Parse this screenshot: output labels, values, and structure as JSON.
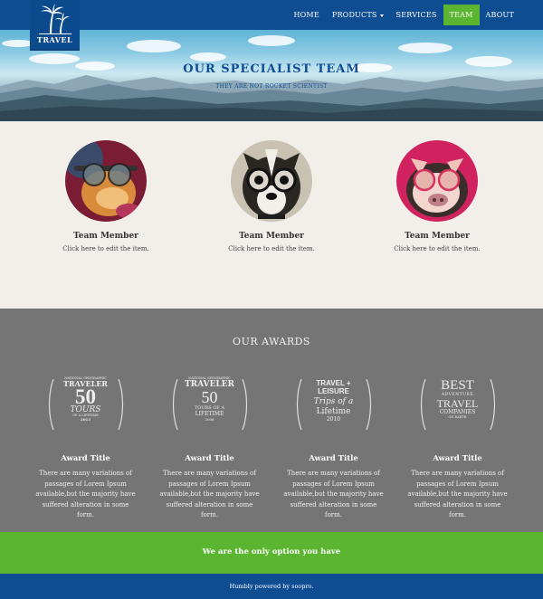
{
  "brand": {
    "name": "TRAVEL",
    "logo_icon": "palm-trees-icon"
  },
  "nav": {
    "items": [
      {
        "label": "HOME",
        "active": false
      },
      {
        "label": "PRODUCTS",
        "active": false,
        "dropdown": true
      },
      {
        "label": "SERVICES",
        "active": false
      },
      {
        "label": "TEAM",
        "active": true
      },
      {
        "label": "ABOUT",
        "active": false
      }
    ]
  },
  "hero": {
    "title": "OUR SPECIALIST TEAM",
    "subtitle": "THEY ARE NOT ROCKET SCIENTIST"
  },
  "team": {
    "members": [
      {
        "name": "Team Member",
        "desc": "Click here to edit the item.",
        "photo": "hamster-with-glasses"
      },
      {
        "name": "Team Member",
        "desc": "Click here to edit the item.",
        "photo": "dog-with-glasses"
      },
      {
        "name": "Team Member",
        "desc": "Click here to edit the item.",
        "photo": "pig-with-glasses"
      }
    ]
  },
  "awards": {
    "title": "OUR AWARDS",
    "items": [
      {
        "badge_lines": [
          "NATIONAL GEOGRAPHIC",
          "TRAVELER",
          "50",
          "TOURS",
          "OF A LIFETIME",
          "2013"
        ],
        "title": "Award Title",
        "desc": "There are many variations of passages of Lorem Ipsum available,but the majority have suffered alteration in some form."
      },
      {
        "badge_lines": [
          "NATIONAL GEOGRAPHIC",
          "TRAVELER",
          "50",
          "TOURS OF A",
          "LIFETIME",
          "2008"
        ],
        "title": "Award Title",
        "desc": "There are many variations of passages of Lorem Ipsum available,but the majority have suffered alteration in some form."
      },
      {
        "badge_lines": [
          "TRAVEL +",
          "LEISURE",
          "Trips of a",
          "Lifetime",
          "2010"
        ],
        "title": "Award Title",
        "desc": "There are many variations of passages of Lorem Ipsum available,but the majority have suffered alteration in some form."
      },
      {
        "badge_lines": [
          "BEST",
          "ADVENTURE",
          "TRAVEL",
          "COMPANIES",
          "ON EARTH"
        ],
        "title": "Award Title",
        "desc": "There are many variations of passages of Lorem Ipsum available,but the majority have suffered alteration in some form."
      }
    ]
  },
  "cta": {
    "text": "We are the only option you have"
  },
  "footer": {
    "text": "Humbly powered by soopro."
  },
  "colors": {
    "primary": "#0f4d92",
    "accent": "#5cb531",
    "awards_bg": "#757575",
    "page_bg": "#f2efea"
  }
}
